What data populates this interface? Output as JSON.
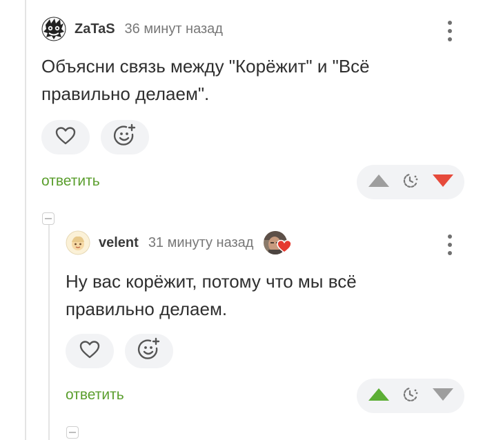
{
  "comments": [
    {
      "username": "ZaTaS",
      "time": "36 минут назад",
      "text_line1": "Объясни связь между \"Корёжит\" и \"Всё",
      "text_line2": "правильно делаем\".",
      "reply_label": "ответить",
      "vote_state": "downvoted",
      "colors": {
        "up": "#9e9e9e",
        "down": "#e64a3b"
      }
    },
    {
      "username": "velent",
      "time": "31 минуту назад",
      "text_line1": "Ну вас корёжит, потому что мы всё",
      "text_line2": "правильно делаем.",
      "reply_label": "ответить",
      "vote_state": "upvoted",
      "colors": {
        "up": "#5cae35",
        "down": "#9e9e9e"
      }
    }
  ],
  "icons": {
    "like": "heart-icon",
    "reaction": "add-reaction-icon",
    "menu": "more-vertical-icon",
    "upvote": "triangle-up-icon",
    "timer": "timer-icon",
    "downvote": "triangle-down-icon",
    "collapse": "collapse-minus-icon"
  },
  "theme": {
    "accent": "#5a9e2d",
    "button_bg": "#f2f3f5",
    "thread_line": "#e4e4e4"
  }
}
